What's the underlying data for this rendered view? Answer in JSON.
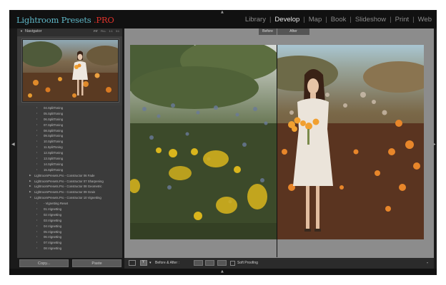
{
  "app": {
    "brand_main": "Lightroom Presets ",
    "brand_accent": ".PRO",
    "modules": [
      "Library",
      "Develop",
      "Map",
      "Book",
      "Slideshow",
      "Print",
      "Web"
    ],
    "active_module": "Develop"
  },
  "navigator": {
    "title": "Navigator",
    "zoom_options": [
      "FIT",
      "FILL",
      "1:1",
      "3:1"
    ]
  },
  "presets": {
    "items": [
      {
        "label": "04.SplitToning",
        "level": "sub"
      },
      {
        "label": "05.SplitToning",
        "level": "sub"
      },
      {
        "label": "06.SplitToning",
        "level": "sub"
      },
      {
        "label": "07.SplitToning",
        "level": "sub"
      },
      {
        "label": "08.SplitToning",
        "level": "sub"
      },
      {
        "label": "09.SplitToning",
        "level": "sub"
      },
      {
        "label": "10.SplitToning",
        "level": "sub"
      },
      {
        "label": "11.SplitToning",
        "level": "sub"
      },
      {
        "label": "12.SplitToning",
        "level": "sub"
      },
      {
        "label": "13.SplitToning",
        "level": "sub"
      },
      {
        "label": "14.SplitToning",
        "level": "sub"
      },
      {
        "label": "15.SplitToning",
        "level": "sub"
      },
      {
        "label": "LightroomPresets.Pro - Constructor 06 Fade",
        "level": "grp",
        "tri": "▶"
      },
      {
        "label": "LightroomPresets.Pro - Constructor 07 Sharpening",
        "level": "grp",
        "tri": "▶"
      },
      {
        "label": "LightroomPresets.Pro - Constructor 08 Geometric",
        "level": "grp",
        "tri": "▶"
      },
      {
        "label": "LightroomPresets.Pro - Constructor 09 Grain",
        "level": "grp",
        "tri": "▶"
      },
      {
        "label": "LightroomPresets.Pro - Constructor 10 Vignetting",
        "level": "grp",
        "tri": "▼"
      },
      {
        "label": "- Vignetting Reset",
        "level": "sub"
      },
      {
        "label": "01.Vignetting",
        "level": "sub"
      },
      {
        "label": "02.Vignetting",
        "level": "sub"
      },
      {
        "label": "03.Vignetting",
        "level": "sub"
      },
      {
        "label": "04.Vignetting",
        "level": "sub"
      },
      {
        "label": "05.Vignetting",
        "level": "sub"
      },
      {
        "label": "06.Vignetting",
        "level": "sub"
      },
      {
        "label": "07.Vignetting",
        "level": "sub"
      },
      {
        "label": "08.Vignetting",
        "level": "sub"
      }
    ]
  },
  "left_buttons": {
    "copy": "Copy...",
    "paste": "Paste"
  },
  "view": {
    "before_label": "Before",
    "after_label": "After"
  },
  "toolbar": {
    "before_after_label": "Before & After :",
    "soft_proofing_label": "Soft Proofing"
  },
  "colors": {
    "brand": "#5fb8c8",
    "brand_accent": "#e0332b",
    "active_module": "#e8e8e8"
  },
  "icons": {
    "top_panel_toggle": "▲",
    "bottom_panel_toggle": "▲",
    "left_panel_toggle": "◀",
    "right_panel_toggle": "▶",
    "navigator_collapse": "▼"
  }
}
